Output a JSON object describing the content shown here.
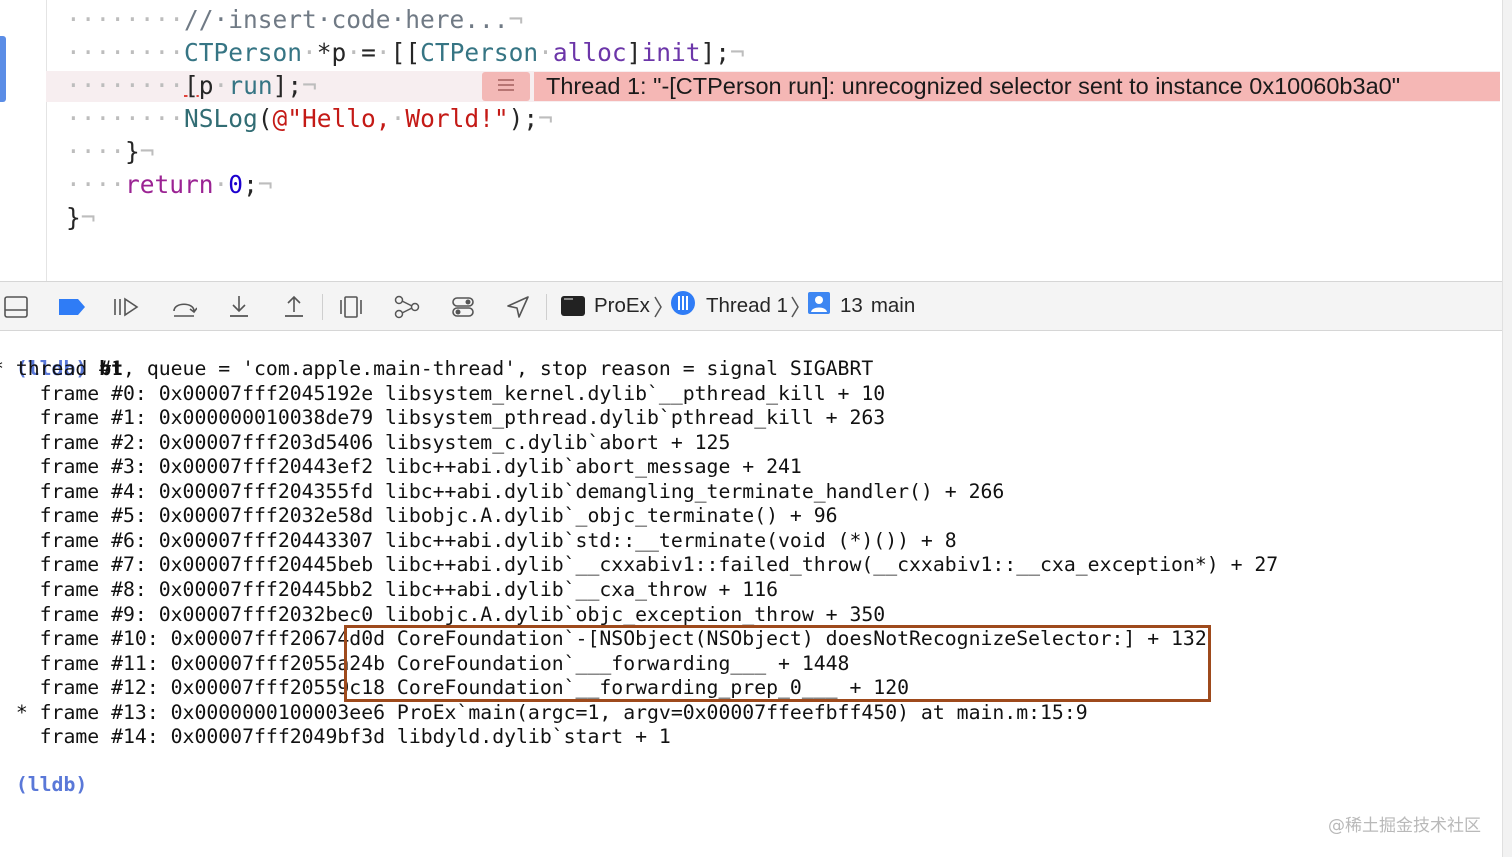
{
  "editor": {
    "lines": [
      {
        "indent": "········",
        "tokens": [
          {
            "t": "//·insert·code·here...",
            "c": "comment"
          },
          {
            "t": "¬",
            "c": "inv"
          }
        ]
      },
      {
        "indent": "········",
        "tokens": [
          {
            "t": "CTPerson",
            "c": "cls"
          },
          {
            "t": "·",
            "c": "inv"
          },
          {
            "t": "*p",
            "c": "plain"
          },
          {
            "t": "·",
            "c": "inv"
          },
          {
            "t": "=",
            "c": "plain"
          },
          {
            "t": "·",
            "c": "inv"
          },
          {
            "t": "[[",
            "c": "plain"
          },
          {
            "t": "CTPerson",
            "c": "cls"
          },
          {
            "t": "·",
            "c": "inv"
          },
          {
            "t": "alloc",
            "c": "meth"
          },
          {
            "t": "]",
            "c": "plain"
          },
          {
            "t": "init",
            "c": "meth"
          },
          {
            "t": "];",
            "c": "plain"
          },
          {
            "t": "¬",
            "c": "inv"
          }
        ]
      },
      {
        "indent": "········",
        "tokens": [
          {
            "t": "[",
            "c": "plain err-underline"
          },
          {
            "t": "p",
            "c": "plain"
          },
          {
            "t": "·",
            "c": "inv"
          },
          {
            "t": "run",
            "c": "cls"
          },
          {
            "t": "];",
            "c": "plain"
          },
          {
            "t": "¬",
            "c": "inv"
          }
        ]
      },
      {
        "indent": "········",
        "tokens": [
          {
            "t": "NSLog",
            "c": "macro"
          },
          {
            "t": "(",
            "c": "plain"
          },
          {
            "t": "@\"Hello,",
            "c": "str"
          },
          {
            "t": "·",
            "c": "inv"
          },
          {
            "t": "World!\"",
            "c": "str"
          },
          {
            "t": ");",
            "c": "plain"
          },
          {
            "t": "¬",
            "c": "inv"
          }
        ]
      },
      {
        "indent": "····",
        "tokens": [
          {
            "t": "}",
            "c": "plain"
          },
          {
            "t": "¬",
            "c": "inv"
          }
        ]
      },
      {
        "indent": "····",
        "tokens": [
          {
            "t": "return",
            "c": "kw"
          },
          {
            "t": "·",
            "c": "inv"
          },
          {
            "t": "0",
            "c": "num"
          },
          {
            "t": ";",
            "c": "plain"
          },
          {
            "t": "¬",
            "c": "inv"
          }
        ]
      },
      {
        "indent": "",
        "tokens": [
          {
            "t": "}",
            "c": "plain"
          },
          {
            "t": "¬",
            "c": "inv"
          }
        ]
      }
    ],
    "error_message": "Thread 1: \"-[CTPerson run]: unrecognized selector sent to instance 0x10060b3a0\""
  },
  "toolbar": {
    "icons": [
      "console-toggle-icon",
      "breakpoints-icon",
      "continue-icon",
      "step-over-icon",
      "step-into-icon",
      "step-out-icon",
      "view-hierarchy-icon",
      "memory-graph-icon",
      "environment-overrides-icon",
      "simulate-location-icon"
    ],
    "breadcrumb": {
      "process": "ProEx",
      "thread": "Thread 1",
      "frame_number": "13",
      "frame_name": "main"
    }
  },
  "console": {
    "prompt": "(lldb)",
    "command": "bt",
    "lines": [
      "* thread #1, queue = 'com.apple.main-thread', stop reason = signal SIGABRT",
      "    frame #0: 0x00007fff2045192e libsystem_kernel.dylib`__pthread_kill + 10",
      "    frame #1: 0x000000010038de79 libsystem_pthread.dylib`pthread_kill + 263",
      "    frame #2: 0x00007fff203d5406 libsystem_c.dylib`abort + 125",
      "    frame #3: 0x00007fff20443ef2 libc++abi.dylib`abort_message + 241",
      "    frame #4: 0x00007fff204355fd libc++abi.dylib`demangling_terminate_handler() + 266",
      "    frame #5: 0x00007fff2032e58d libobjc.A.dylib`_objc_terminate() + 96",
      "    frame #6: 0x00007fff20443307 libc++abi.dylib`std::__terminate(void (*)()) + 8",
      "    frame #7: 0x00007fff20445beb libc++abi.dylib`__cxxabiv1::failed_throw(__cxxabiv1::__cxa_exception*) + 27",
      "    frame #8: 0x00007fff20445bb2 libc++abi.dylib`__cxa_throw + 116",
      "    frame #9: 0x00007fff2032bec0 libobjc.A.dylib`objc_exception_throw + 350",
      "    frame #10: 0x00007fff20674d0d CoreFoundation`-[NSObject(NSObject) doesNotRecognizeSelector:] + 132",
      "    frame #11: 0x00007fff2055a24b CoreFoundation`___forwarding___ + 1448",
      "    frame #12: 0x00007fff20559c18 CoreFoundation`__forwarding_prep_0___ + 120",
      "  * frame #13: 0x0000000100003ee6 ProEx`main(argc=1, argv=0x00007ffeefbff450) at main.m:15:9",
      "    frame #14: 0x00007fff2049bf3d libdyld.dylib`start + 1"
    ],
    "final_prompt": "(lldb)"
  },
  "watermark": "@稀土掘金技术社区",
  "colors": {
    "error_banner": "#f5b7b5",
    "highlight_box": "#9e4a1c",
    "prompt": "#5a78d8",
    "accent_blue": "#2f7cf6"
  }
}
